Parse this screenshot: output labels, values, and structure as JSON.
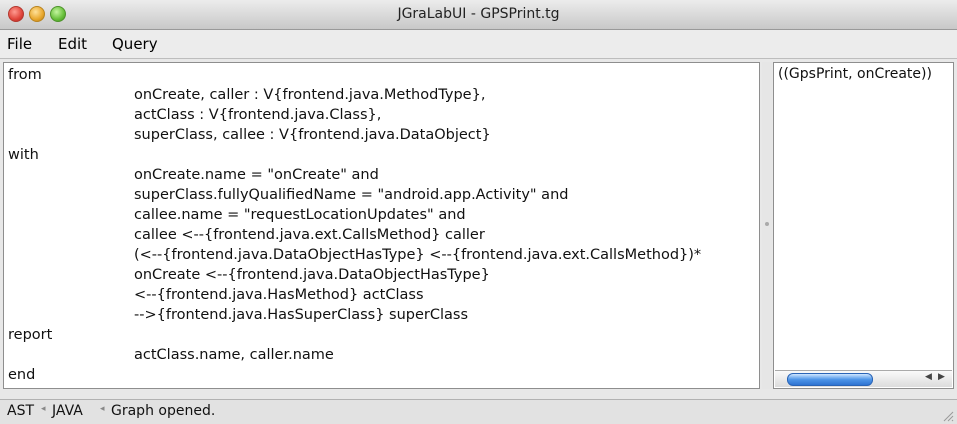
{
  "window": {
    "title": "JGraLabUI - GPSPrint.tg"
  },
  "menubar": {
    "items": [
      "File",
      "Edit",
      "Query"
    ]
  },
  "editor": {
    "lines": [
      {
        "text": "from",
        "indent": false
      },
      {
        "text": "onCreate, caller : V{frontend.java.MethodType},",
        "indent": true
      },
      {
        "text": "actClass : V{frontend.java.Class},",
        "indent": true
      },
      {
        "text": "superClass, callee : V{frontend.java.DataObject}",
        "indent": true
      },
      {
        "text": "with",
        "indent": false
      },
      {
        "text": "onCreate.name = \"onCreate\" and",
        "indent": true
      },
      {
        "text": "superClass.fullyQualifiedName = \"android.app.Activity\" and",
        "indent": true
      },
      {
        "text": "callee.name = \"requestLocationUpdates\" and",
        "indent": true
      },
      {
        "text": "callee <--{frontend.java.ext.CallsMethod} caller",
        "indent": true
      },
      {
        "text": "(<--{frontend.java.DataObjectHasType} <--{frontend.java.ext.CallsMethod})*",
        "indent": true
      },
      {
        "text": "onCreate <--{frontend.java.DataObjectHasType}",
        "indent": true
      },
      {
        "text": "<--{frontend.java.HasMethod} actClass",
        "indent": true
      },
      {
        "text": "-->{frontend.java.HasSuperClass} superClass",
        "indent": true
      },
      {
        "text": "report",
        "indent": false
      },
      {
        "text": "actClass.name, caller.name",
        "indent": true
      },
      {
        "text": "end",
        "indent": false
      }
    ]
  },
  "results": {
    "items": [
      "((GpsPrint, onCreate))"
    ]
  },
  "statusbar": {
    "segments": [
      "AST",
      "JAVA",
      "Graph opened."
    ]
  },
  "icons": {
    "close": "close-button-icon",
    "minimize": "minimize-button-icon",
    "maximize": "zoom-button-icon",
    "scroll_left": "arrow-left-icon",
    "scroll_right": "arrow-right-icon",
    "resize": "resize-grip-icon"
  },
  "colors": {
    "close": "#e0443a",
    "minimize": "#e8a72d",
    "maximize": "#67bf3a",
    "scroll_thumb": "#4e95e8"
  }
}
